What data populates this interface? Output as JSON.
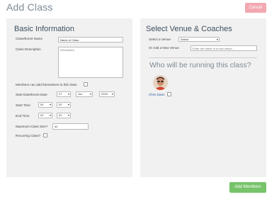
{
  "header": {
    "title": "Add Class",
    "cancel_label": "Cancel"
  },
  "basic_info": {
    "heading": "Basic Information",
    "class_name_label": "Class/Event Name",
    "class_name_value": "Name of Class",
    "description_label": "Class Description",
    "description_placeholder": "Description",
    "members_add_label": "Members can add themselves to this class",
    "start_date_label": "Start Date/Event Date",
    "start_day": "27",
    "start_month": "Jun",
    "start_year": "2015",
    "start_time_label": "Start Time",
    "start_hour": "00",
    "start_minute": "00",
    "end_time_label": "End Time",
    "end_hour": "00",
    "end_minute": "00",
    "max_size_label": "Maximum Class Size?",
    "max_size_value": "40",
    "recurring_label": "Recurring Class?"
  },
  "venue": {
    "heading": "Select Venue & Coaches",
    "select_label": "Select a Venue",
    "select_value": "Select",
    "new_venue_label": "Or Add a New Venue",
    "new_venue_placeholder": "Enter the name of a new venue..."
  },
  "coaches": {
    "heading": "Who will be running this class?",
    "items": [
      {
        "name": "Chris Davis"
      }
    ]
  },
  "footer": {
    "add_members_label": "Add Members"
  },
  "colors": {
    "cancel": "#f2a8b0",
    "add_members": "#76c36a",
    "panel": "#f1f1f1",
    "coach_link": "#2b5fa6"
  }
}
